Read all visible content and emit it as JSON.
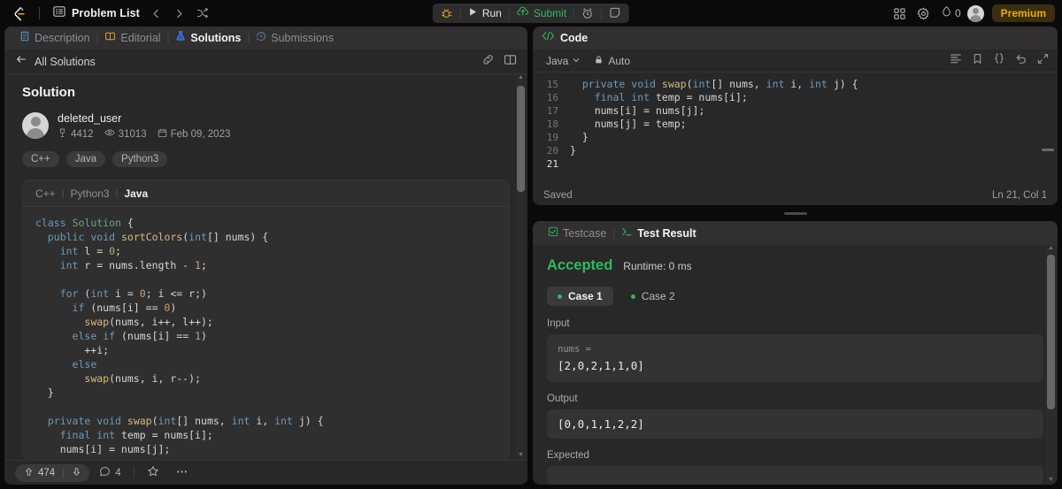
{
  "topnav": {
    "logo_icon": "leetcode-logo-icon",
    "problem_list_icon": "list-icon",
    "problem_list_label": "Problem List",
    "prev_icon": "chevron-left-icon",
    "next_icon": "chevron-right-icon",
    "shuffle_icon": "shuffle-icon",
    "debug_icon": "debug-bug-icon",
    "run_icon": "play-icon",
    "run_label": "Run",
    "submit_icon": "cloud-upload-icon",
    "submit_label": "Submit",
    "timer_icon": "timer-icon",
    "note_icon": "note-icon",
    "grid_icon": "grid-apps-icon",
    "settings_icon": "gear-icon",
    "streak_icon": "flame-icon",
    "streak_count": "0",
    "avatar_icon": "avatar",
    "premium_label": "Premium"
  },
  "left_panel": {
    "tabs": [
      {
        "label": "Description",
        "icon": "description-icon",
        "active": false
      },
      {
        "label": "Editorial",
        "icon": "editorial-book-icon",
        "active": false
      },
      {
        "label": "Solutions",
        "icon": "solutions-flask-icon",
        "active": true
      },
      {
        "label": "Submissions",
        "icon": "submissions-clock-icon",
        "active": false
      }
    ],
    "back_icon": "arrow-left-icon",
    "back_label": "All Solutions",
    "link_icon": "link-icon",
    "layout_icon": "layout-columns-icon",
    "solution_title": "Solution",
    "author": {
      "name": "deleted_user",
      "reputation_icon": "medal-icon",
      "reputation": "4412",
      "views_icon": "eye-icon",
      "views": "31013",
      "date_icon": "calendar-icon",
      "date": "Feb 09, 2023"
    },
    "language_chips": [
      "C++",
      "Java",
      "Python3"
    ],
    "code_card_tabs": [
      {
        "label": "C++",
        "active": false
      },
      {
        "label": "Python3",
        "active": false
      },
      {
        "label": "Java",
        "active": true
      }
    ],
    "code": {
      "language": "java",
      "lines": [
        "class Solution {",
        "  public void sortColors(int[] nums) {",
        "    int l = 0;",
        "    int r = nums.length - 1;",
        "",
        "    for (int i = 0; i <= r;)",
        "      if (nums[i] == 0)",
        "        swap(nums, i++, l++);",
        "      else if (nums[i] == 1)",
        "        ++i;",
        "      else",
        "        swap(nums, i, r--);",
        "  }",
        "",
        "  private void swap(int[] nums, int i, int j) {",
        "    final int temp = nums[i];",
        "    nums[i] = nums[j];"
      ]
    },
    "footer": {
      "upvote_icon": "arrow-up-icon",
      "upvote_count": "474",
      "downvote_icon": "arrow-down-icon",
      "comment_icon": "comment-icon",
      "comment_count": "4",
      "star_icon": "star-icon",
      "more_icon": "ellipsis-icon"
    }
  },
  "code_panel": {
    "title_icon": "code-brackets-icon",
    "title": "Code",
    "language": "Java",
    "language_chevron_icon": "chevron-down-icon",
    "lock_icon": "lock-icon",
    "auto_label": "Auto",
    "toolbar_icons": [
      "format-lines-icon",
      "bookmark-icon",
      "curly-braces-icon",
      "undo-icon",
      "expand-icon"
    ],
    "line_numbers": [
      "15",
      "16",
      "17",
      "18",
      "19",
      "20",
      "21"
    ],
    "current_line": "21",
    "lines": [
      "  private void swap(int[] nums, int i, int j) {",
      "    final int temp = nums[i];",
      "    nums[i] = nums[j];",
      "    nums[j] = temp;",
      "  }",
      "}",
      ""
    ],
    "status_left": "Saved",
    "status_right": "Ln 21, Col 1"
  },
  "result_panel": {
    "tabs": [
      {
        "label": "Testcase",
        "icon": "checkbox-icon",
        "active": false
      },
      {
        "label": "Test Result",
        "icon": "terminal-icon",
        "active": true
      }
    ],
    "verdict": "Accepted",
    "runtime": "Runtime: 0 ms",
    "cases": [
      {
        "label": "Case 1",
        "active": true
      },
      {
        "label": "Case 2",
        "active": false
      }
    ],
    "input_label": "Input",
    "input_key": "nums =",
    "input_value": "[2,0,2,1,1,0]",
    "output_label": "Output",
    "output_value": "[0,0,1,1,2,2]",
    "expected_label": "Expected"
  },
  "colors": {
    "accent_green": "#2cbb5d",
    "premium_gold": "#f0ab00",
    "panel_bg": "#282828",
    "page_bg": "#0a0a0a",
    "keyword_blue": "#6c99bb",
    "type_green": "#6aa785",
    "function_yellow": "#d7ba7d"
  }
}
